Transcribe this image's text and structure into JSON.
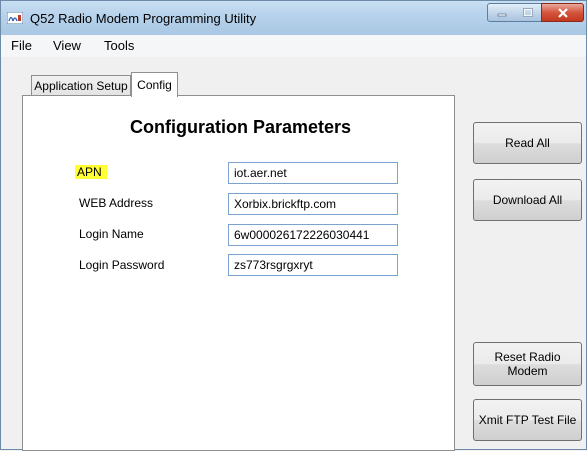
{
  "window": {
    "title": "Q52 Radio Modem Programming Utility"
  },
  "menu": {
    "file": "File",
    "view": "View",
    "tools": "Tools"
  },
  "tabs": {
    "application_setup": "Application Setup",
    "config": "Config"
  },
  "config": {
    "heading": "Configuration Parameters",
    "apn_label": "APN",
    "apn_value": "iot.aer.net",
    "web_label": "WEB Address",
    "web_value": "Xorbix.brickftp.com",
    "login_name_label": "Login Name",
    "login_name_value": "6w000026172226030441",
    "login_password_label": "Login Password",
    "login_password_value": "zs773rsgrgxryt"
  },
  "buttons": {
    "read_all": "Read All",
    "download_all": "Download All",
    "reset_radio_modem_line1": "Reset Radio",
    "reset_radio_modem_line2": "Modem",
    "xmit_ftp": "Xmit FTP Test File"
  },
  "colors": {
    "highlight": "#ffff33",
    "field_border": "#7ba3cf",
    "titlebar": "#b8d3ec"
  },
  "icons": [
    "app-icon",
    "minimize-icon",
    "maximize-icon",
    "close-icon"
  ]
}
